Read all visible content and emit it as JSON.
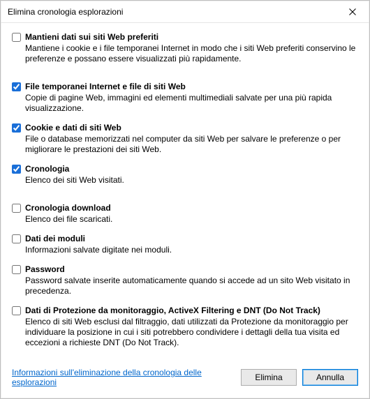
{
  "window": {
    "title": "Elimina cronologia esplorazioni"
  },
  "options": [
    {
      "key": "preserve-favorites",
      "checked": false,
      "label": "Mantieni dati sui siti Web preferiti",
      "desc": "Mantiene i cookie e i file temporanei Internet in modo che i siti Web preferiti conservino le preferenze e possano essere visualizzati più rapidamente."
    },
    {
      "key": "temp-internet-files",
      "checked": true,
      "label": "File temporanei Internet e file di siti Web",
      "desc": "Copie di pagine Web, immagini ed elementi multimediali salvate per una più rapida visualizzazione."
    },
    {
      "key": "cookies",
      "checked": true,
      "label": "Cookie e dati di siti Web",
      "desc": "File o database memorizzati nel computer da siti Web per salvare le preferenze o per migliorare le prestazioni dei siti Web."
    },
    {
      "key": "history",
      "checked": true,
      "label": "Cronologia",
      "desc": "Elenco dei siti Web visitati."
    },
    {
      "key": "download-history",
      "checked": false,
      "label": "Cronologia download",
      "desc": "Elenco dei file scaricati."
    },
    {
      "key": "form-data",
      "checked": false,
      "label": "Dati dei moduli",
      "desc": "Informazioni salvate digitate nei moduli."
    },
    {
      "key": "passwords",
      "checked": false,
      "label": "Password",
      "desc": "Password salvate inserite automaticamente quando si accede ad un sito Web visitato in precedenza."
    },
    {
      "key": "tracking-protection",
      "checked": false,
      "label": "Dati di Protezione da monitoraggio, ActiveX Filtering e DNT (Do Not Track)",
      "desc": "Elenco di siti Web esclusi dal filtraggio, dati utilizzati da Protezione da monitoraggio per individuare la posizione in cui i siti potrebbero condividere i dettagli della tua visita ed eccezioni a richieste DNT (Do Not Track)."
    }
  ],
  "footer": {
    "info_link": "Informazioni sull'eliminazione della cronologia delle esplorazioni",
    "delete_label": "Elimina",
    "cancel_label": "Annulla"
  }
}
